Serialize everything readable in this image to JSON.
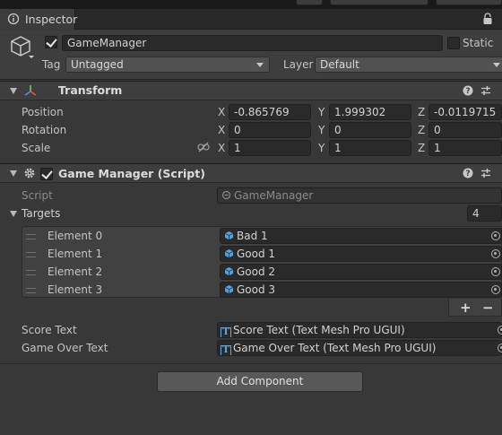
{
  "window": {
    "tab_label": "Inspector"
  },
  "gameobject": {
    "active": true,
    "name": "GameManager",
    "static_label": "Static",
    "tag_label": "Tag",
    "tag_value": "Untagged",
    "layer_label": "Layer",
    "layer_value": "Default"
  },
  "transform": {
    "title": "Transform",
    "rows": [
      {
        "label": "Position",
        "x": "-0.865769",
        "y": "1.999302",
        "z": "-0.0119715"
      },
      {
        "label": "Rotation",
        "x": "0",
        "y": "0",
        "z": "0"
      },
      {
        "label": "Scale",
        "x": "1",
        "y": "1",
        "z": "1"
      }
    ],
    "axis": {
      "x": "X",
      "y": "Y",
      "z": "Z"
    }
  },
  "script_component": {
    "enabled": true,
    "title": "Game Manager (Script)",
    "script_label": "Script",
    "script_value": "GameManager",
    "targets_label": "Targets",
    "targets_count": "4",
    "elements": [
      {
        "label": "Element 0",
        "value": "Bad 1"
      },
      {
        "label": "Element 1",
        "value": "Good 1"
      },
      {
        "label": "Element 2",
        "value": "Good 2"
      },
      {
        "label": "Element 3",
        "value": "Good 3"
      }
    ],
    "add_glyph": "+",
    "remove_glyph": "−",
    "score_text_label": "Score Text",
    "score_text_value": "Score Text (Text Mesh Pro UGUI)",
    "game_over_label": "Game Over Text",
    "game_over_value": "Game Over Text (Text Mesh Pro UGUI)",
    "tmp_glyph": "T"
  },
  "add_component_label": "Add Component",
  "colors": {
    "accent_blue": "#62a8e0",
    "background": "#383838",
    "header": "#3e3e3e"
  }
}
